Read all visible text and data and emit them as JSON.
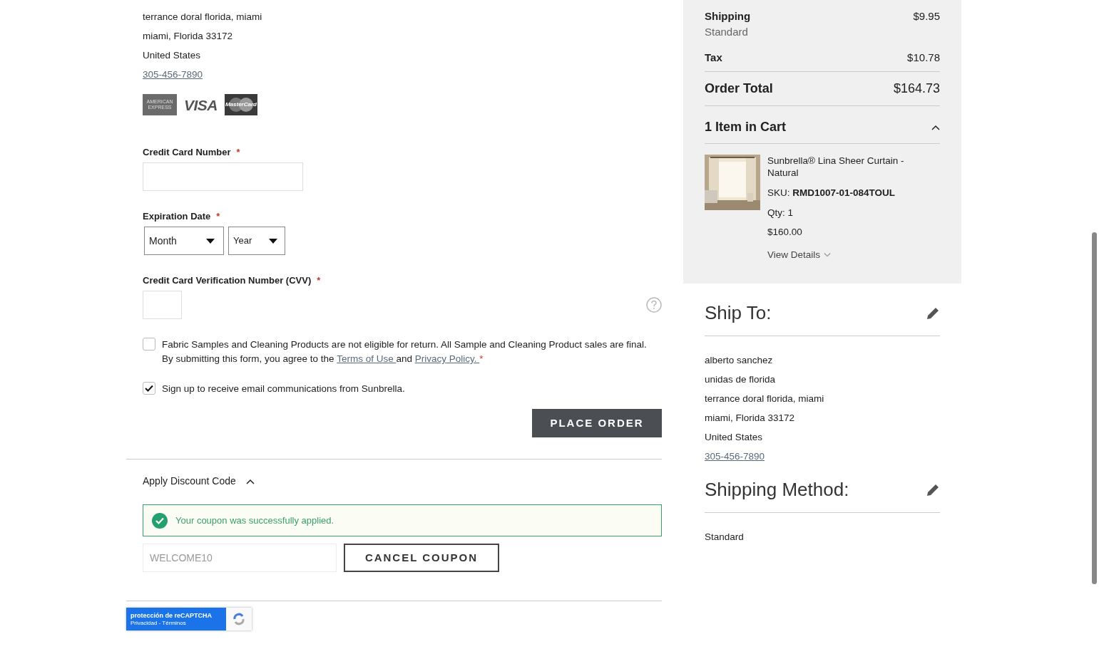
{
  "billing_address": {
    "lines": [
      "terrance doral florida, miami",
      "miami, Florida 33172",
      "United States"
    ],
    "phone": "305-456-7890"
  },
  "card_logos": [
    {
      "kind": "amex",
      "label": "AMERICAN EXPRESS"
    },
    {
      "kind": "visa",
      "label": "VISA"
    },
    {
      "kind": "mastercard",
      "label": "MasterCard"
    }
  ],
  "payment_form": {
    "card_number": {
      "label": "Credit Card Number",
      "required_mark": "*"
    },
    "expiration": {
      "label": "Expiration Date",
      "required_mark": "*",
      "month": "Month",
      "year": "Year"
    },
    "cvv": {
      "label": "Credit Card Verification Number (CVV)",
      "required_mark": "*"
    }
  },
  "agreements": [
    {
      "kind": "terms",
      "checked": false,
      "text": "Fabric Samples and Cleaning Products are not eligible for return. All Sample and Cleaning Product sales are final. By submitting this form, you agree to the",
      "link1": "Terms of Use ",
      "middle": "and",
      "link2": "Privacy Policy. ",
      "required_mark": "*"
    },
    {
      "kind": "plain",
      "checked": true,
      "text": "Sign up to receive email communications from Sunbrella."
    }
  ],
  "place_order": "PLACE ORDER",
  "discount": {
    "title": "Apply Discount Code",
    "expanded": true,
    "message": "Your coupon was successfully applied.",
    "code": "WELCOME10",
    "cancel": "CANCEL COUPON"
  },
  "recaptcha": {
    "title": "protección de reCAPTCHA",
    "links": "Privacidad - Términos"
  },
  "summary": {
    "rows": [
      {
        "label": "Shipping",
        "sub": "Standard",
        "value": "$9.95"
      },
      {
        "label": "Tax",
        "value": "$10.78"
      }
    ],
    "total_label": "Order Total",
    "total_value": "$164.73",
    "cart_title": "1 Item in Cart",
    "cart_expanded": true,
    "item": {
      "kind": "picture",
      "name": "Sunbrella® Lina Sheer Curtain - Natural",
      "sku_label": "SKU:",
      "sku": "RMD1007-01-084TOUL",
      "qty": "Qty: 1",
      "price": "$160.00",
      "details": "View Details"
    }
  },
  "ship_to": {
    "title": "Ship To:",
    "lines": [
      "alberto sanchez",
      "unidas de florida",
      "terrance doral florida, miami",
      "miami, Florida 33172",
      "United States"
    ],
    "phone": "305-456-7890"
  },
  "shipping_method": {
    "title": "Shipping Method:",
    "value": "Standard"
  }
}
